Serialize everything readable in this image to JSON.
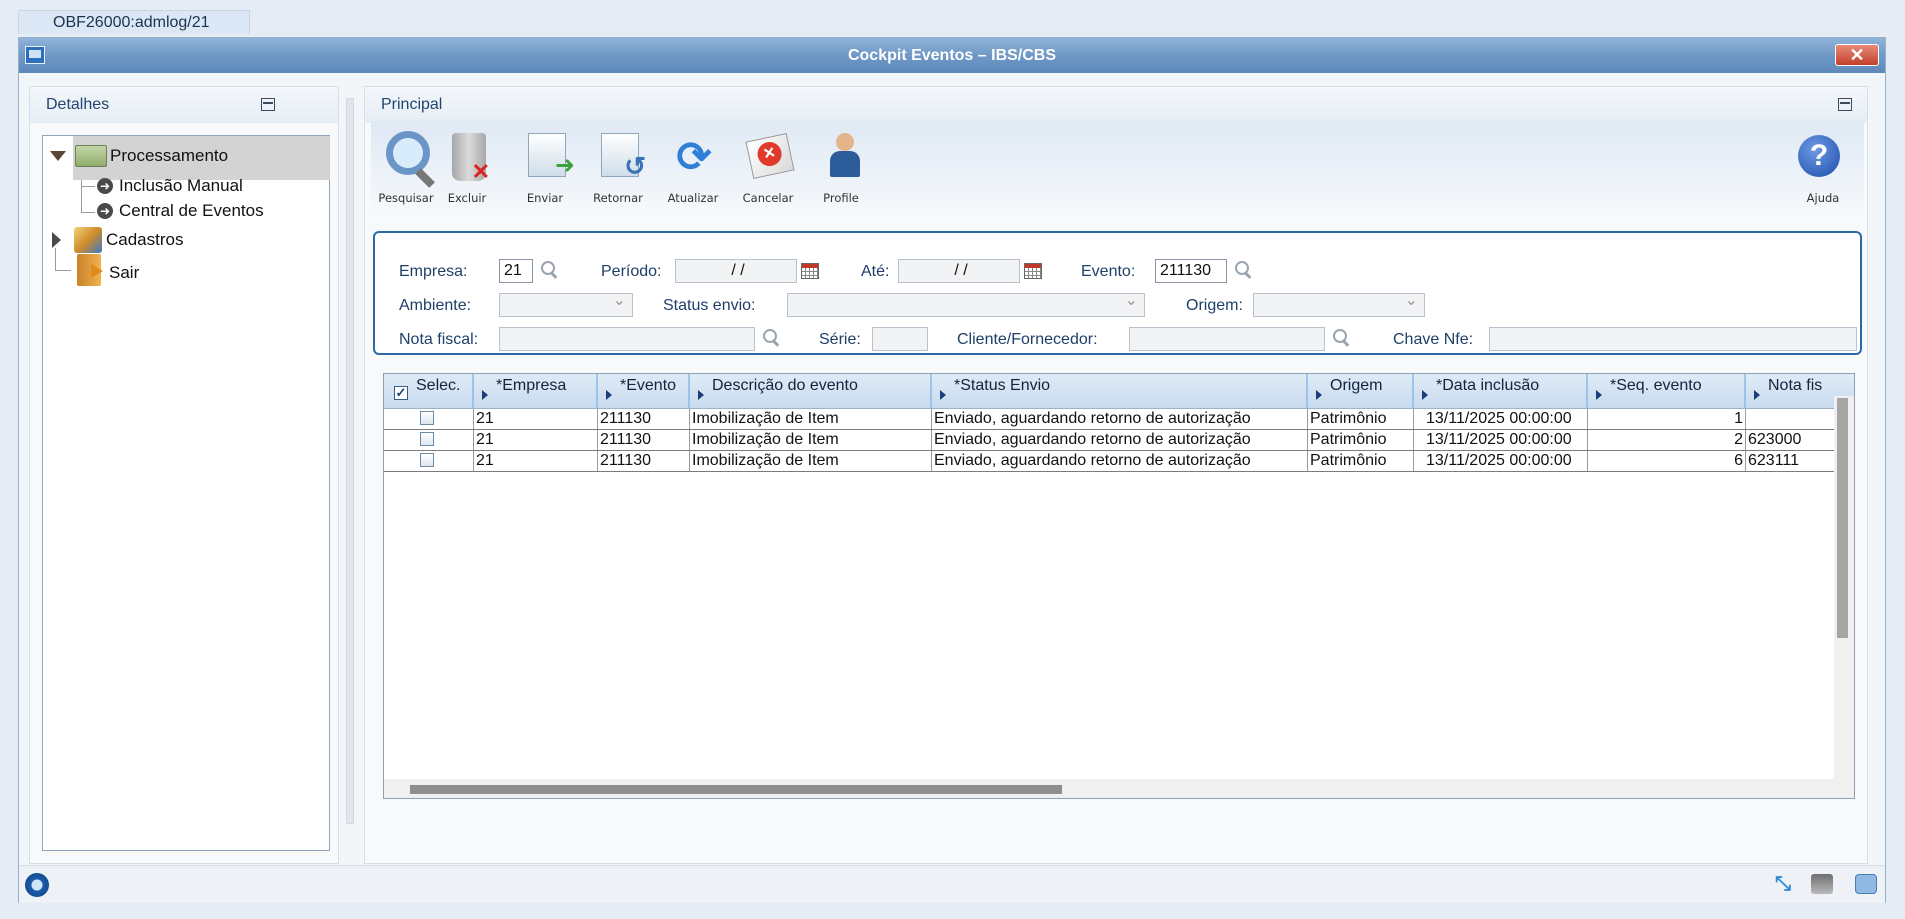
{
  "top_tab": {
    "label": "OBF26000:admlog/21"
  },
  "window": {
    "title": "Cockpit Eventos – IBS/CBS",
    "close_label": "✕"
  },
  "left_panel": {
    "title": "Detalhes",
    "tree": [
      {
        "label": "Processamento",
        "icon": "folder-open-icon",
        "expanded": true,
        "children": [
          {
            "label": "Inclusão Manual"
          },
          {
            "label": "Central de Eventos"
          }
        ]
      },
      {
        "label": "Cadastros",
        "icon": "registry-icon",
        "expanded": false
      },
      {
        "label": "Sair",
        "icon": "exit-door-icon"
      }
    ]
  },
  "right_panel": {
    "title": "Principal",
    "toolbar": [
      {
        "label": "Pesquisar",
        "icon": "magnifier-icon"
      },
      {
        "label": "Excluir",
        "icon": "trash-icon"
      },
      {
        "label": "Enviar",
        "icon": "send-document-icon"
      },
      {
        "label": "Retornar",
        "icon": "return-document-icon"
      },
      {
        "label": "Atualizar",
        "icon": "refresh-icon"
      },
      {
        "label": "Cancelar",
        "icon": "cancel-icon"
      },
      {
        "label": "Profile",
        "icon": "profile-icon"
      },
      {
        "label": "Ajuda",
        "icon": "help-icon"
      }
    ],
    "filters": {
      "empresa_label": "Empresa:",
      "empresa_value": "21",
      "periodo_label": "Período:",
      "periodo_value": "/ /",
      "ate_label": "Até:",
      "ate_value": "/ /",
      "evento_label": "Evento:",
      "evento_value": "211130",
      "ambiente_label": "Ambiente:",
      "ambiente_value": "",
      "status_label": "Status envio:",
      "status_value": "",
      "origem_label": "Origem:",
      "origem_value": "",
      "nota_label": "Nota fiscal:",
      "nota_value": "",
      "serie_label": "Série:",
      "serie_value": "",
      "cliente_label": "Cliente/Fornecedor:",
      "cliente_value": "",
      "chave_label": "Chave Nfe:",
      "chave_value": ""
    },
    "grid": {
      "columns": [
        "Selec.",
        "*Empresa",
        "*Evento",
        "Descrição do evento",
        "*Status Envio",
        "Origem",
        "*Data inclusão",
        "*Seq. evento",
        "Nota fis"
      ],
      "rows": [
        {
          "empresa": "21",
          "evento": "211130",
          "descricao": "Imobilização de Item",
          "status": "Enviado, aguardando retorno de autorização",
          "origem": "Patrimônio",
          "data": "13/11/2025 00:00:00",
          "seq": "1",
          "nota": ""
        },
        {
          "empresa": "21",
          "evento": "211130",
          "descricao": "Imobilização de Item",
          "status": "Enviado, aguardando retorno de autorização",
          "origem": "Patrimônio",
          "data": "13/11/2025 00:00:00",
          "seq": "2",
          "nota": "623000"
        },
        {
          "empresa": "21",
          "evento": "211130",
          "descricao": "Imobilização de Item",
          "status": "Enviado, aguardando retorno de autorização",
          "origem": "Patrimônio",
          "data": "13/11/2025 00:00:00",
          "seq": "6",
          "nota": "623111"
        }
      ]
    }
  },
  "statusbar": {
    "icons": [
      "app-logo-icon",
      "resize-icon",
      "print-icon",
      "chat-icon"
    ]
  }
}
